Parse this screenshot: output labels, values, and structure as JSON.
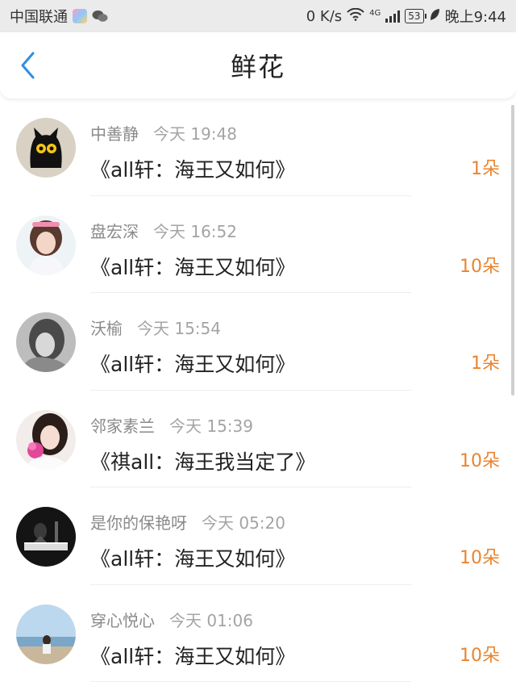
{
  "status_bar": {
    "carrier": "中国联通",
    "speed": "0 K/s",
    "network": "4G",
    "battery": "53",
    "time": "晚上9:44"
  },
  "header": {
    "title": "鲜花",
    "back_icon": "chevron-left-icon"
  },
  "colors": {
    "accent_blue": "#2f8fe0",
    "count_orange": "#e9842f"
  },
  "items": [
    {
      "username": "中善静",
      "time": "今天 19:48",
      "title": "《all轩：海王又如何》",
      "count": "1朵"
    },
    {
      "username": "盘宏深",
      "time": "今天 16:52",
      "title": "《all轩：海王又如何》",
      "count": "10朵"
    },
    {
      "username": "沃榆",
      "time": "今天 15:54",
      "title": "《all轩：海王又如何》",
      "count": "1朵"
    },
    {
      "username": "邻家素兰",
      "time": "今天 15:39",
      "title": "《祺all：海王我当定了》",
      "count": "10朵"
    },
    {
      "username": "是你的保艳呀",
      "time": "今天 05:20",
      "title": "《all轩：海王又如何》",
      "count": "10朵"
    },
    {
      "username": "穿心悦心",
      "time": "今天 01:06",
      "title": "《all轩：海王又如何》",
      "count": "10朵"
    }
  ]
}
